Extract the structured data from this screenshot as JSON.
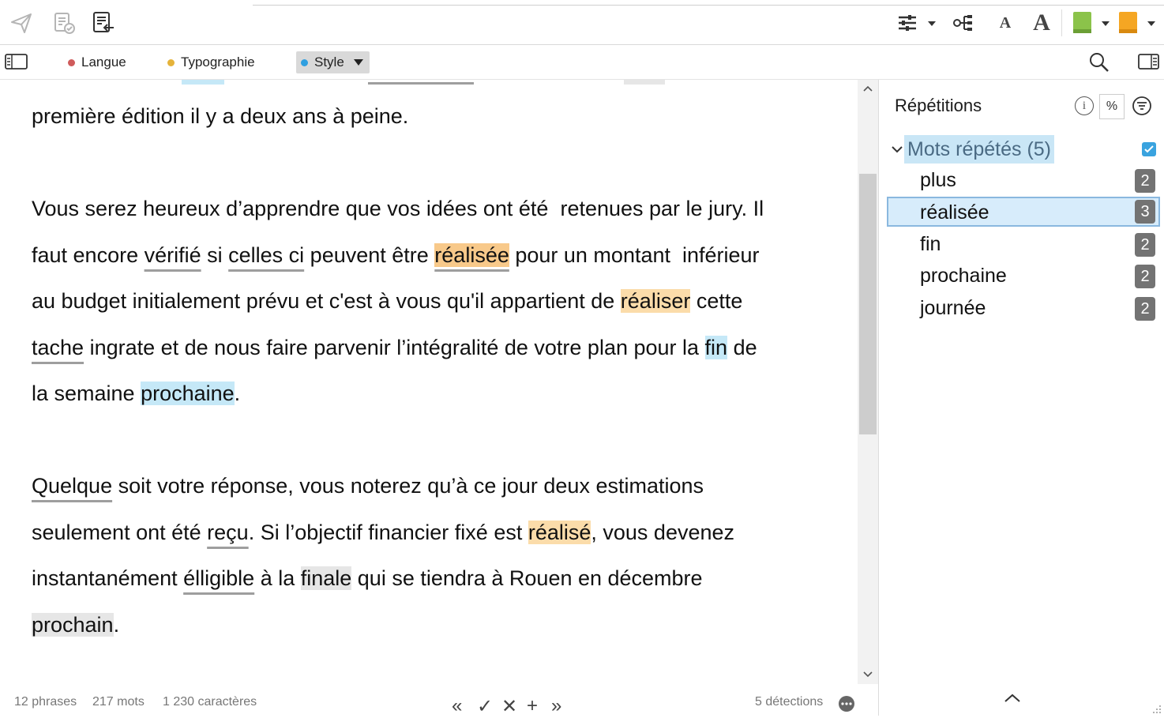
{
  "toolbar": {
    "left_icons": [
      "send-icon",
      "document-check-icon",
      "document-import-icon"
    ],
    "right_icons": [
      "settings-sliders-icon",
      "outline-tree-icon",
      "font-small-icon",
      "font-large-icon",
      "green-book-icon",
      "orange-book-icon"
    ],
    "font_small": "A",
    "font_large": "A"
  },
  "tabs": {
    "langue": "Langue",
    "typographie": "Typographie",
    "style": "Style",
    "colors": {
      "langue": "#cf5b5b",
      "typographie": "#e5b33a",
      "style": "#2f9fe0"
    }
  },
  "editor": {
    "l1": "première édition il y a deux ans à peine.",
    "p2": {
      "a1": "Vous serez heureux d’apprendre que vos idées ont été  retenues par le jury. Il",
      "b1": "faut encore ",
      "b2": "vérifié",
      "b3": " si ",
      "b4": "celles ci",
      "b5": " peuvent être ",
      "b6": "réalisée",
      "b7": " pour un montant  inférieur",
      "c1": "au budget initialement prévu et c'est à vous qu'il appartient de ",
      "c2": "réaliser",
      "c3": " cette",
      "d1": "tache",
      "d2": " ingrate et de nous faire parvenir l’intégralité de votre plan pour la ",
      "d3": "fin",
      "d4": " de",
      "e1": "la semaine ",
      "e2": "prochaine",
      "e3": "."
    },
    "p3": {
      "a1": "Quelque",
      "a2": " soit votre réponse, vous noterez qu’à ce jour deux estimations",
      "b1": "seulement ont été ",
      "b2": "reçu",
      "b3": ". Si l’objectif financier fixé est ",
      "b4": "réalisé",
      "b5": ", vous devenez",
      "c1": "instantanément ",
      "c2": "élligible",
      "c3": " à la ",
      "c4": "finale",
      "c5": " qui se tiendra à Rouen en décembre",
      "d1": "prochain",
      "d2": "."
    }
  },
  "status": {
    "phrases": "12 phrases",
    "mots": "217 mots",
    "caracteres": "1 230 caractères",
    "detections": "5 détections",
    "nav": {
      "prev": "«",
      "accept": "✓",
      "reject": "✕",
      "add": "+",
      "next": "»"
    }
  },
  "panel": {
    "title": "Répétitions",
    "percent": "%",
    "info": "i",
    "group": "Mots répétés (5)",
    "items": [
      {
        "word": "plus",
        "count": "2"
      },
      {
        "word": "réalisée",
        "count": "3"
      },
      {
        "word": "fin",
        "count": "2"
      },
      {
        "word": "prochaine",
        "count": "2"
      },
      {
        "word": "journée",
        "count": "2"
      }
    ]
  }
}
